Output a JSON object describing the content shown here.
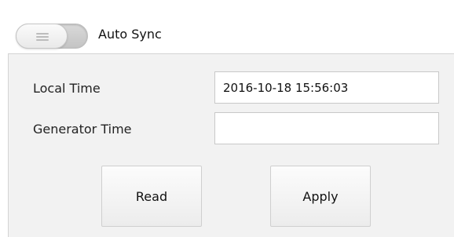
{
  "auto_sync": {
    "label": "Auto Sync",
    "enabled": false
  },
  "fields": {
    "local_time": {
      "label": "Local Time",
      "value": "2016-10-18 15:56:03"
    },
    "generator_time": {
      "label": "Generator Time",
      "value": ""
    }
  },
  "buttons": {
    "read_label": "Read",
    "apply_label": "Apply"
  }
}
